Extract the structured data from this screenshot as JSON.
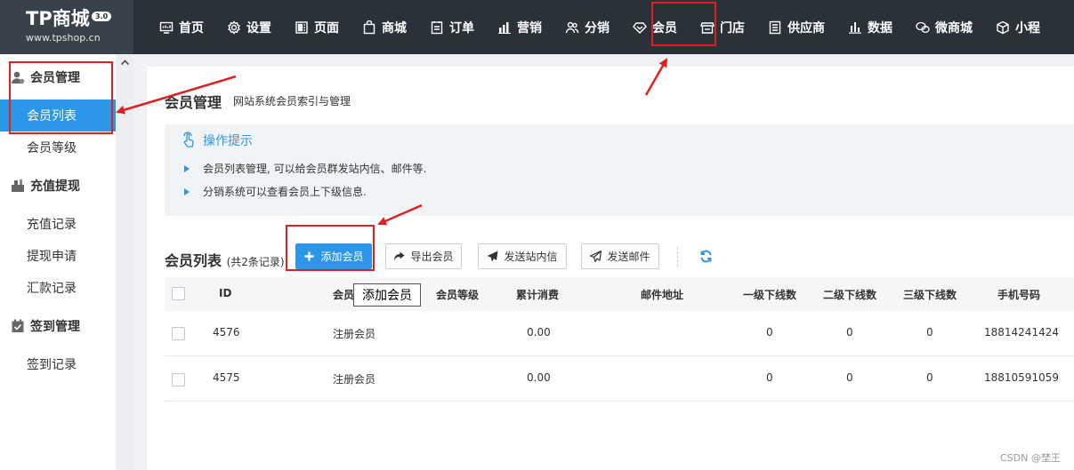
{
  "logo": {
    "name": "TP商城",
    "version": "3.0",
    "url": "www.tpshop.cn"
  },
  "nav": [
    {
      "label": "首页",
      "icon": "monitor-icon"
    },
    {
      "label": "设置",
      "icon": "gear-icon"
    },
    {
      "label": "页面",
      "icon": "page-icon"
    },
    {
      "label": "商城",
      "icon": "bag-icon"
    },
    {
      "label": "订单",
      "icon": "order-icon"
    },
    {
      "label": "营销",
      "icon": "bar-chart-icon"
    },
    {
      "label": "分销",
      "icon": "users-icon"
    },
    {
      "label": "会员",
      "icon": "diamond-icon"
    },
    {
      "label": "门店",
      "icon": "store-icon"
    },
    {
      "label": "供应商",
      "icon": "list-icon"
    },
    {
      "label": "数据",
      "icon": "stats-icon"
    },
    {
      "label": "微商城",
      "icon": "wechat-icon"
    },
    {
      "label": "小程",
      "icon": "cube-icon"
    }
  ],
  "sidebar": {
    "groups": [
      {
        "title": "会员管理",
        "icon": "member-manage-icon",
        "items": [
          "会员列表",
          "会员等级"
        ]
      },
      {
        "title": "充值提现",
        "icon": "recharge-icon",
        "items": [
          "充值记录",
          "提现申请",
          "汇款记录"
        ]
      },
      {
        "title": "签到管理",
        "icon": "checkin-icon",
        "items": [
          "签到记录"
        ]
      }
    ],
    "active": "会员列表"
  },
  "page": {
    "title": "会员管理",
    "subtitle": "网站系统会员索引与管理",
    "tips_title": "操作提示",
    "tips": [
      "会员列表管理, 可以给会员群发站内信、邮件等.",
      "分销系统可以查看会员上下级信息."
    ]
  },
  "list": {
    "title": "会员列表",
    "count": "(共2条记录)",
    "buttons": {
      "add": "添加会员",
      "export": "导出会员",
      "message": "发送站内信",
      "email": "发送邮件"
    },
    "tooltip": "添加会员",
    "columns": [
      "ID",
      "会员",
      "会员等级",
      "累计消费",
      "邮件地址",
      "一级下线数",
      "二级下线数",
      "三级下线数",
      "手机号码"
    ],
    "rows": [
      {
        "id": "4576",
        "level": "注册会员",
        "spent": "0.00",
        "l1": "0",
        "l2": "0",
        "l3": "0",
        "phone": "18814241424"
      },
      {
        "id": "4575",
        "level": "注册会员",
        "spent": "0.00",
        "l1": "0",
        "l2": "0",
        "l3": "0",
        "phone": "18810591059"
      }
    ]
  },
  "watermark": "CSDN @埜王",
  "colors": {
    "topbar": "#2b3138",
    "accent": "#2c97e8",
    "annotation": "#e02020"
  }
}
